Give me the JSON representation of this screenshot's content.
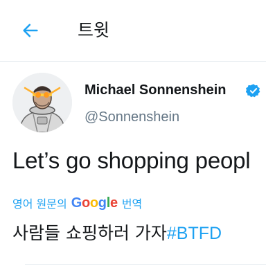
{
  "header": {
    "title": "트윗",
    "back_icon": "back-arrow-icon"
  },
  "tweet": {
    "display_name": "Michael Sonnenshein",
    "handle": "@Sonnenshein",
    "text": "Let’s go shopping peopl",
    "verified_icon": "verified-badge-icon",
    "translate": {
      "prefix": "영어 원문의",
      "provider": "Google",
      "suffix": "번역"
    },
    "translation": {
      "text": "사람들 쇼핑하러 가자",
      "hashtag": "#BTFD"
    }
  },
  "colors": {
    "accent": "#1da1f2",
    "text_primary": "#14171a",
    "text_secondary": "#657786",
    "divider": "#e6ecf0"
  }
}
